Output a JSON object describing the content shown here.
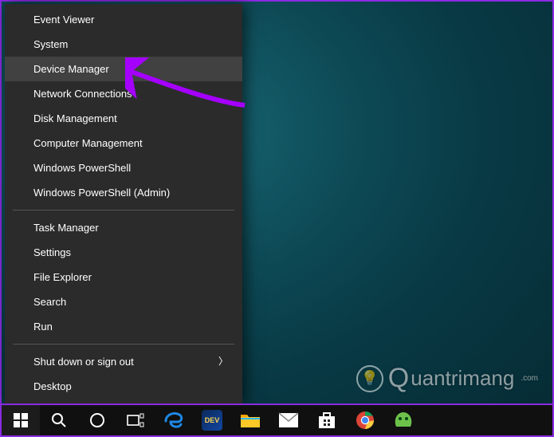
{
  "winx_menu": {
    "groups": [
      [
        {
          "label": "Event Viewer"
        },
        {
          "label": "System"
        },
        {
          "label": "Device Manager",
          "highlighted": true
        },
        {
          "label": "Network Connections"
        },
        {
          "label": "Disk Management"
        },
        {
          "label": "Computer Management"
        },
        {
          "label": "Windows PowerShell"
        },
        {
          "label": "Windows PowerShell (Admin)"
        }
      ],
      [
        {
          "label": "Task Manager"
        },
        {
          "label": "Settings"
        },
        {
          "label": "File Explorer"
        },
        {
          "label": "Search"
        },
        {
          "label": "Run"
        }
      ],
      [
        {
          "label": "Shut down or sign out",
          "submenu": true
        },
        {
          "label": "Desktop"
        }
      ]
    ]
  },
  "annotation": {
    "arrow_color": "#a500ff",
    "points_to": "Device Manager"
  },
  "taskbar": {
    "buttons": [
      {
        "id": "start",
        "name": "start-button",
        "icon": "windows-logo-icon"
      },
      {
        "id": "search",
        "name": "search-button",
        "icon": "search-icon"
      },
      {
        "id": "cortana",
        "name": "cortana-button",
        "icon": "cortana-icon"
      },
      {
        "id": "taskview",
        "name": "task-view-button",
        "icon": "task-view-icon"
      },
      {
        "id": "edge",
        "name": "edge-app",
        "icon": "edge-icon"
      },
      {
        "id": "devapp",
        "name": "dev-app",
        "icon": "dev-app-icon"
      },
      {
        "id": "explorer",
        "name": "file-explorer-app",
        "icon": "folder-icon"
      },
      {
        "id": "mail",
        "name": "mail-app",
        "icon": "mail-icon"
      },
      {
        "id": "store",
        "name": "store-app",
        "icon": "store-icon"
      },
      {
        "id": "chrome",
        "name": "chrome-app",
        "icon": "chrome-icon"
      },
      {
        "id": "green",
        "name": "green-app",
        "icon": "green-blob-icon"
      }
    ]
  },
  "watermark": {
    "text": "uantrimang",
    "lead_glyph": "Q"
  },
  "colors": {
    "menu_bg": "#2b2b2b",
    "menu_hover": "#414141",
    "taskbar_bg": "#101010",
    "accent_border": "#8a2be2"
  }
}
